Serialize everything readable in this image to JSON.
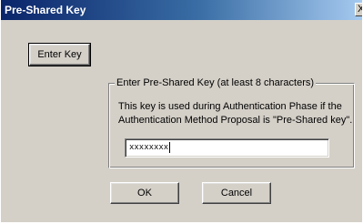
{
  "window": {
    "title": "Pre-Shared Key",
    "close_glyph": "X"
  },
  "buttons": {
    "enter_key": "Enter Key",
    "ok": "OK",
    "cancel": "Cancel"
  },
  "group": {
    "legend": "Enter Pre-Shared Key (at least 8 characters)",
    "description_line1": "This key is used during Authentication Phase if the",
    "description_line2": "Authentication Method Proposal is \"Pre-Shared key\"."
  },
  "key_field": {
    "value_masked": "xxxxxxxx"
  }
}
